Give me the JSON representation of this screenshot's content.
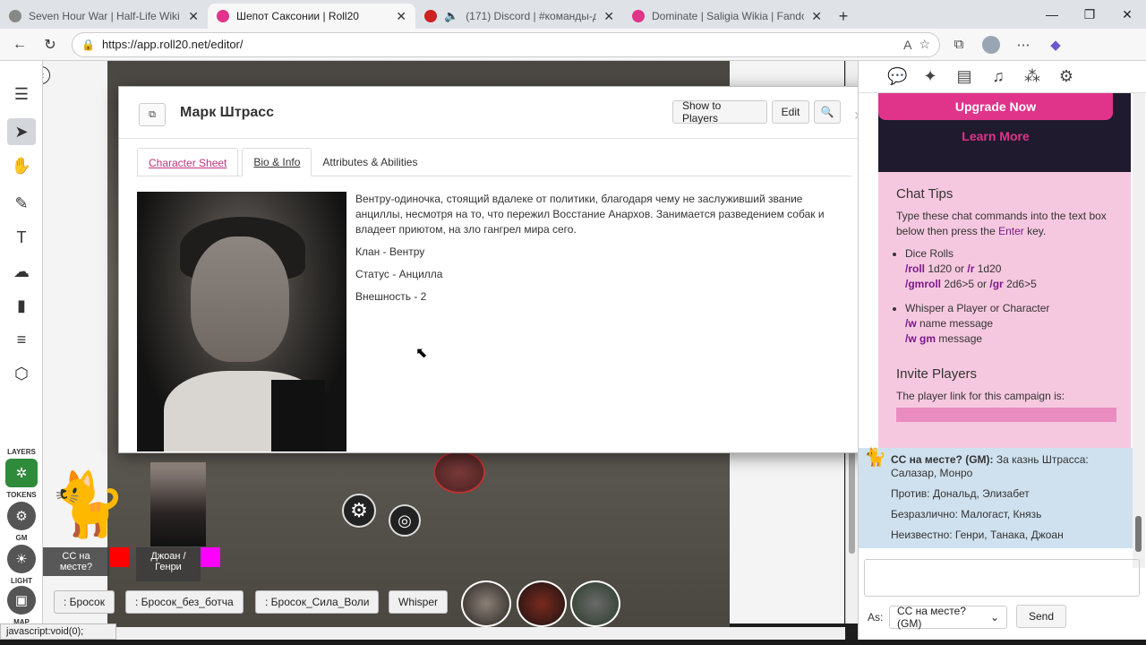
{
  "browser": {
    "tabs": [
      {
        "label": "Seven Hour War | Half-Life Wiki | F",
        "favicon_color": "#888888"
      },
      {
        "label": "Шепот Саксонии | Roll20",
        "favicon_color": "#e0338a"
      },
      {
        "label": "(171) Discord | #команды-д",
        "favicon_color": "#cc2222"
      },
      {
        "label": "Dominate | Saligia Wikia | Fandom",
        "favicon_color": "#e0338a"
      }
    ],
    "url": "https://app.roll20.net/editor/",
    "status_url": "javascript:void(0);"
  },
  "dialog": {
    "title": "Марк Штрасс",
    "buttons": {
      "show": "Show to Players",
      "edit": "Edit"
    },
    "tabs": [
      "Character Sheet",
      "Bio & Info",
      "Attributes & Abilities"
    ],
    "bio": {
      "paragraph": "Вентру-одиночка, стоящий вдалеке от политики, благодаря чему не заслуживший звание анциллы, несмотря на то, что пережил Восстание Анархов. Занимается разведением собак и владеет приютом, на зло гангрел мира сего.",
      "clan": "Клан - Вентру",
      "status": "Статус - Анцилла",
      "appearance": "Внешность - 2"
    }
  },
  "left_toolbar": {
    "layers_label": "LAYERS",
    "tokens_label": "TOKENS",
    "gm_label": "GM",
    "light_label": "LIGHT",
    "map_label": "MAP"
  },
  "players": [
    {
      "label": "СС на месте?",
      "color": "#ff0000"
    },
    {
      "label": "Джоан / Генри",
      "color": "#ff00ff"
    }
  ],
  "macros": [
    ": Бросок",
    ": Бросок_без_ботча",
    ": Бросок_Сила_Воли",
    "Whisper"
  ],
  "right_panel": {
    "upgrade": "Upgrade Now",
    "learn": "Learn More",
    "tips_title": "Chat Tips",
    "tips_intro_a": "Type these chat commands into the text box below then press the ",
    "tips_intro_key": "Enter",
    "tips_intro_b": " key.",
    "dice_title": "Dice Rolls",
    "dice_line1_cmd1": "/roll",
    "dice_line1_arg1": " 1d20 or ",
    "dice_line1_cmd2": "/r",
    "dice_line1_arg2": " 1d20",
    "dice_line2_cmd1": "/gmroll",
    "dice_line2_arg1": " 2d6>5 or ",
    "dice_line2_cmd2": "/gr",
    "dice_line2_arg2": " 2d6>5",
    "whisper_title": "Whisper a Player or Character",
    "whisper_cmd1": "/w",
    "whisper_arg1": " name message",
    "whisper_cmd2": "/w gm",
    "whisper_arg2": " message",
    "invite_title": "Invite Players",
    "invite_text": "The player link for this campaign is:",
    "chat": {
      "who": "СС на месте? (GM):",
      "first": " За казнь Штрасса: Салазар, Монро",
      "against": "Против: Дональд, Элизабет",
      "neutral": "Безразлично: Малогаст, Князь",
      "unknown": "Неизвестно: Генри, Танака, Джоан"
    },
    "as_label": "As:",
    "as_value": "СС на месте? (GM)",
    "send": "Send"
  }
}
